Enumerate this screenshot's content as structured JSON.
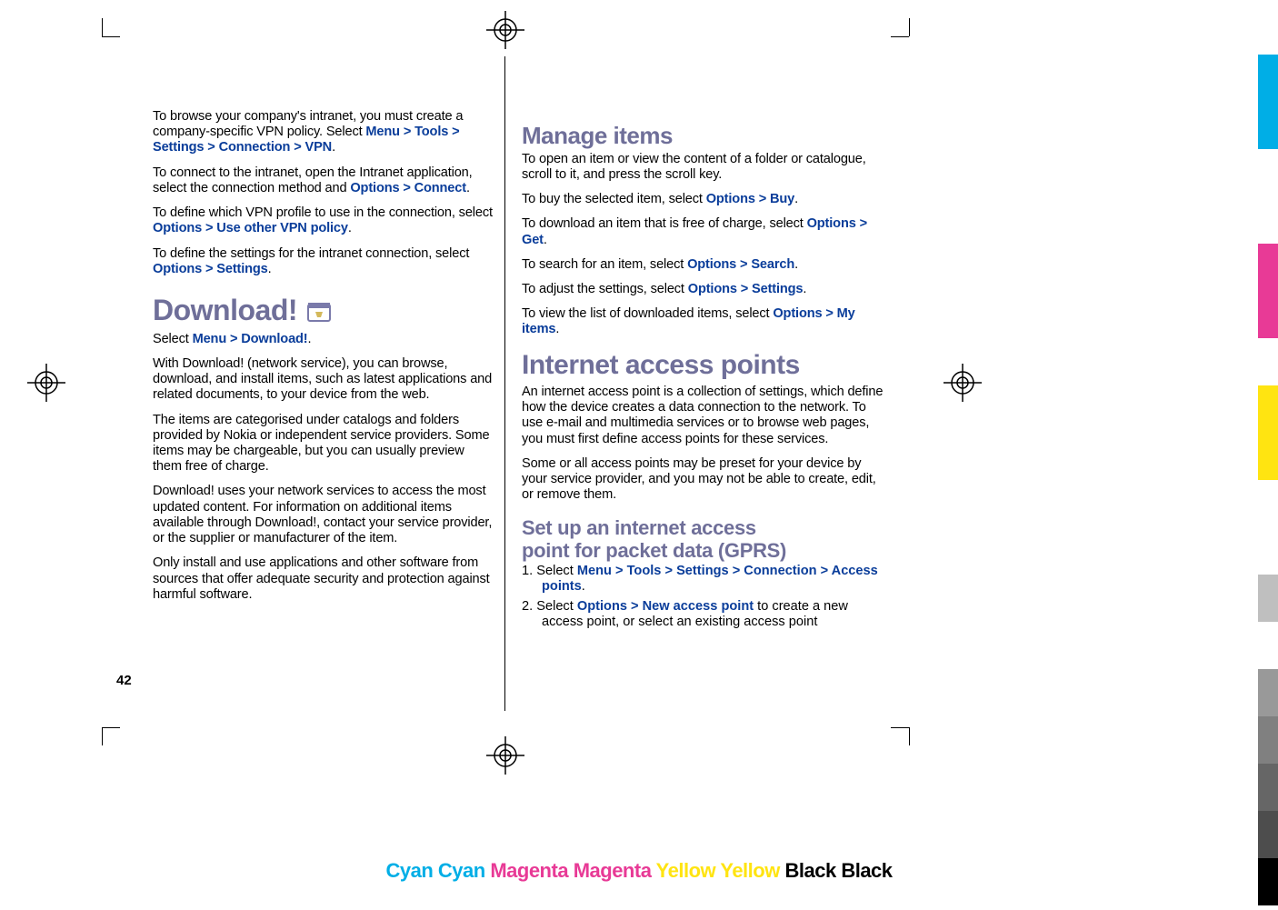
{
  "page_number": "42",
  "left": {
    "p1_a": "To browse your company's intranet, you must create a company-specific VPN policy. Select ",
    "p1_menu": "Menu",
    "p1_tools": "Tools",
    "p1_settings": "Settings",
    "p1_connection": "Connection",
    "p1_vpn": "VPN",
    "p2_a": "To connect to the intranet, open the Intranet application, select the connection method and ",
    "p2_options": "Options",
    "p2_connect": "Connect",
    "p3_a": "To define which VPN profile to use in the connection, select ",
    "p3_options": "Options",
    "p3_use": "Use other VPN policy",
    "p4_a": "To define the settings for the intranet connection, select ",
    "p4_options": "Options",
    "p4_settings": "Settings",
    "h1": "Download!",
    "p5_a": "Select ",
    "p5_menu": "Menu",
    "p5_dl": "Download!",
    "p6": "With Download! (network service), you can browse, download, and install items, such as latest applications and related documents, to your device from the web.",
    "p7": "The items are categorised under catalogs and folders provided by Nokia or independent service providers. Some items may be chargeable, but you can usually preview them free of charge.",
    "p8": "Download! uses your network services to access the most updated content. For information on additional items available through Download!, contact your service provider, or the supplier or manufacturer of the item.",
    "p9": "Only install and use applications and other software from sources that offer adequate security and protection against harmful software."
  },
  "right": {
    "h2": "Manage items",
    "p1": "To open an item or view the content of a folder or catalogue, scroll to it, and press the scroll key.",
    "p2_a": "To buy the selected item, select ",
    "p2_options": "Options",
    "p2_buy": "Buy",
    "p3_a": "To download an item that is free of charge, select ",
    "p3_options": "Options",
    "p3_get": "Get",
    "p4_a": "To search for an item, select ",
    "p4_options": "Options",
    "p4_search": "Search",
    "p5_a": "To adjust the settings, select ",
    "p5_options": "Options",
    "p5_settings": "Settings",
    "p6_a": "To view the list of downloaded items, select ",
    "p6_options": "Options",
    "p6_my": "My items",
    "h1b": "Internet access points",
    "p7": "An internet access point is a collection of settings, which define how the device creates a data connection to the network. To use e-mail and multimedia services or to browse web pages, you must first define access points for these services.",
    "p8": "Some or all access points may be preset for your device by your service provider, and you may not be able to create, edit, or remove them.",
    "h3a": "Set up an internet access",
    "h3b": "point for packet data (GPRS)",
    "li1_a": "1.  Select ",
    "li1_menu": "Menu",
    "li1_tools": "Tools",
    "li1_settings": "Settings",
    "li1_conn": "Connection",
    "li1_ap": "Access points",
    "li2_a": "2.  Select ",
    "li2_options": "Options",
    "li2_new": "New access point",
    "li2_b": " to create a new access point, or select an existing access point"
  },
  "footer": {
    "cyan": "Cyan",
    "magenta": "Magenta",
    "yellow": "Yellow",
    "black": "Black"
  },
  "swatch_colors": [
    "#00aee6",
    "#00aee6",
    "#ffffff",
    "#ffffff",
    "#e83a96",
    "#e83a96",
    "#ffffff",
    "#ffe411",
    "#ffe411",
    "#ffffff",
    "#ffffff",
    "#bfbfbf",
    "#ffffff",
    "#999999",
    "#808080",
    "#666666",
    "#4d4d4d",
    "#000000"
  ]
}
